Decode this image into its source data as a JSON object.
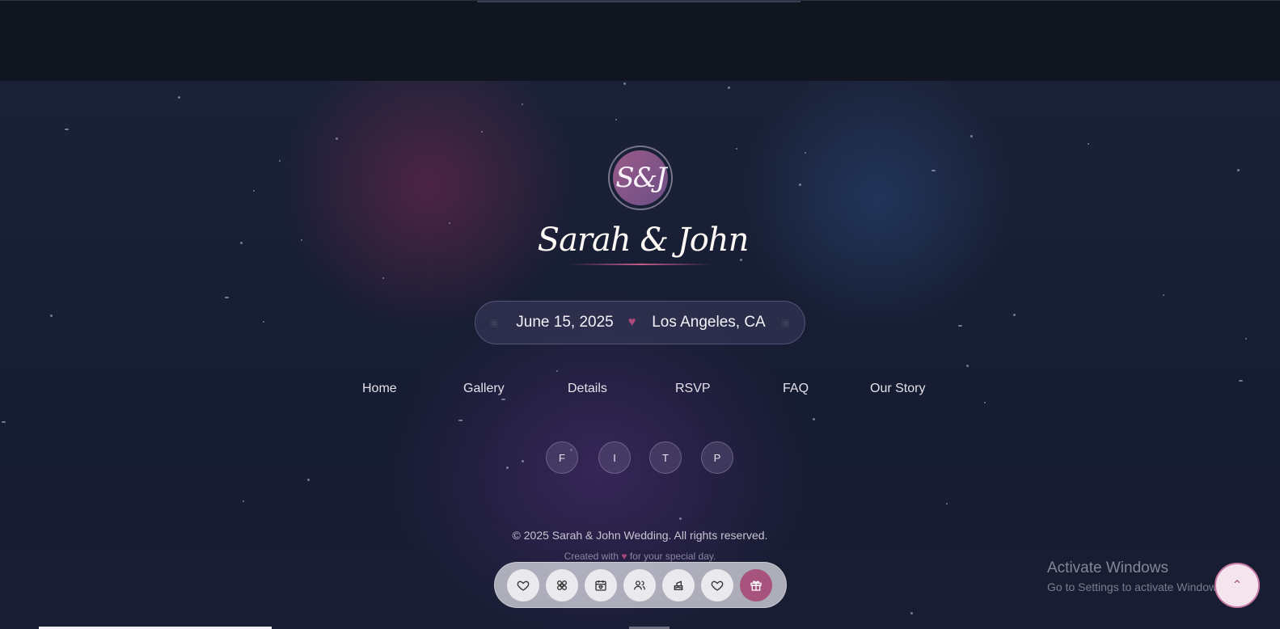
{
  "monogram": "S&J",
  "couple_names": "Sarah & John",
  "event": {
    "date": "June 15, 2025",
    "location": "Los Angeles, CA"
  },
  "nav": {
    "items": [
      "Home",
      "Gallery",
      "Details",
      "RSVP",
      "FAQ",
      "Our Story"
    ]
  },
  "social": {
    "buttons": [
      "F",
      "I",
      "T",
      "P"
    ]
  },
  "footer": {
    "copyright": "© 2025 Sarah & John Wedding. All rights reserved.",
    "created_prefix": "Created with",
    "created_suffix": "for your special day."
  },
  "dock": {
    "items": [
      "heart-icon",
      "flower-icon",
      "calendar-heart-icon",
      "people-icon",
      "cake-icon",
      "heart-icon",
      "gift-icon"
    ],
    "active": "gift-icon"
  },
  "watermark": {
    "title": "Activate Windows",
    "subtitle": "Go to Settings to activate Windows."
  },
  "colors": {
    "accent": "#a8527e",
    "background": "#161c31"
  }
}
